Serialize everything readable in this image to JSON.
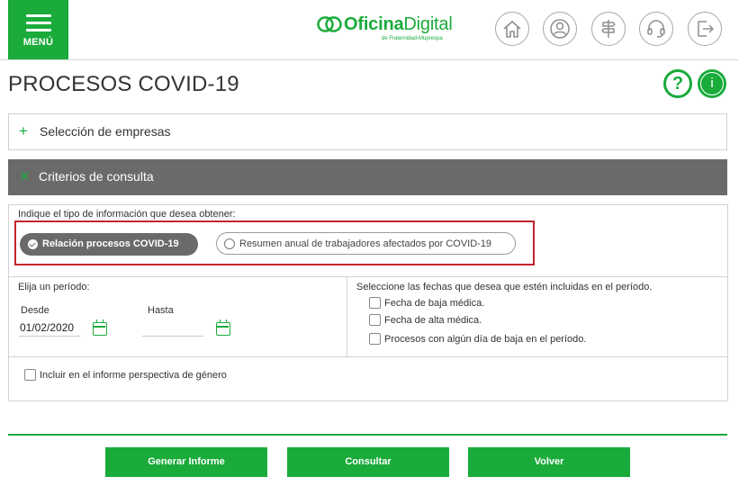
{
  "header": {
    "menu_label": "MENÚ",
    "brand_bold": "Oficina",
    "brand_light": "Digital",
    "brand_tagline": "de Fraternidad-Muprespa",
    "icons": [
      "home-icon",
      "user-icon",
      "signpost-icon",
      "headset-icon",
      "logout-icon"
    ]
  },
  "page": {
    "title": "PROCESOS COVID-19",
    "help_glyph": "?",
    "info_glyph": "i"
  },
  "accordions": {
    "empresas": {
      "symbol": "+",
      "label": "Selección de empresas"
    },
    "criterios": {
      "symbol": "✕",
      "label": "Criterios de consulta"
    }
  },
  "form": {
    "type_question": "Indique el tipo de información que desea obtener:",
    "type_options": [
      {
        "label": "Relación procesos COVID-19",
        "selected": true
      },
      {
        "label": "Resumen anual de trabajadores afectados por COVID-19",
        "selected": false
      }
    ],
    "periodo_label": "Elija un período:",
    "desde_label": "Desde",
    "desde_value": "01/02/2020",
    "hasta_label": "Hasta",
    "hasta_value": "",
    "fechas_label": "Seleccione las fechas que desea que estén incluidas en el período.",
    "fechas_options": [
      {
        "label": "Fecha de baja médica.",
        "checked": false
      },
      {
        "label": "Fecha de alta médica.",
        "checked": false
      },
      {
        "label": "Procesos con algún día de baja en el período.",
        "checked": false
      }
    ],
    "genero_label": "Incluir en el informe perspectiva de género",
    "genero_checked": false
  },
  "actions": {
    "generar": "Generar Informe",
    "consultar": "Consultar",
    "volver": "Volver"
  },
  "colors": {
    "accent": "#1aab3b",
    "header_bar": "#6a6a6a",
    "highlight_border": "#c4232f"
  }
}
